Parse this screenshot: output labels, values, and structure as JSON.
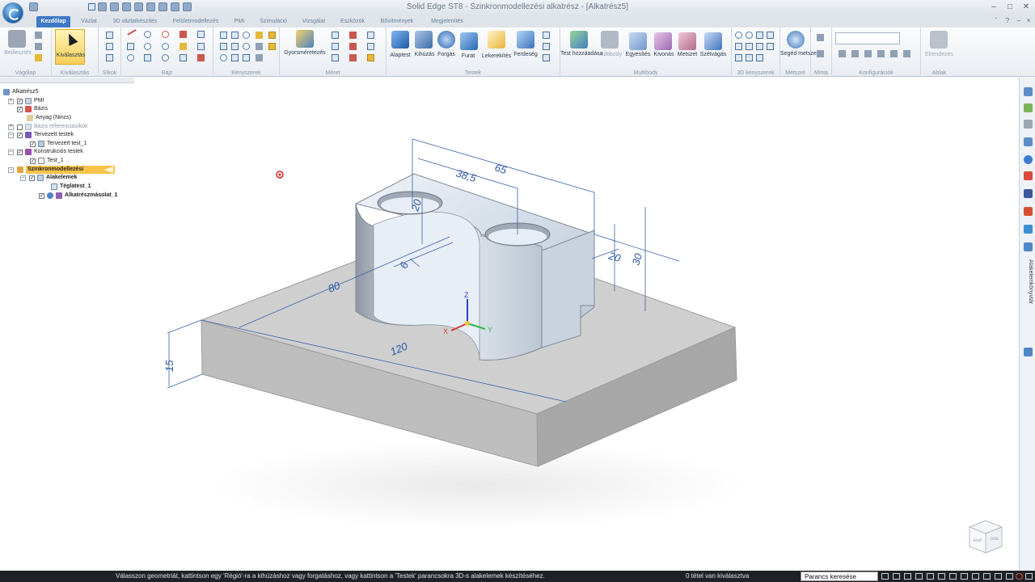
{
  "window": {
    "title": "Solid Edge ST8 - Szinkronmodellezési alkatrész - [Alkatrész5]"
  },
  "tabs": [
    {
      "label": "Kezdőlap",
      "active": true
    },
    {
      "label": "Vázlat"
    },
    {
      "label": "3D vázlatkészítés"
    },
    {
      "label": "Felületmodellezés"
    },
    {
      "label": "PMI"
    },
    {
      "label": "Szimuláció"
    },
    {
      "label": "Vizsgálat"
    },
    {
      "label": "Eszközök"
    },
    {
      "label": "Bővítmények"
    },
    {
      "label": "Megjelenítés"
    }
  ],
  "ribbon": {
    "groups": [
      {
        "label": "Vágólap"
      },
      {
        "label": "Kiválasztás"
      },
      {
        "label": "Síkok"
      },
      {
        "label": "Rajz"
      },
      {
        "label": "Kényszerek"
      },
      {
        "label": "Méret"
      },
      {
        "label": "Testek"
      },
      {
        "label": "Multibody"
      },
      {
        "label": "3D kényszerek"
      },
      {
        "label": "Metszet"
      },
      {
        "label": "Minta"
      },
      {
        "label": "Konfigurációk"
      },
      {
        "label": "Ablak"
      }
    ],
    "buttons": {
      "paste": "Beillesztés",
      "select": "Kiválasztás",
      "smart_dimension": "Gyorsméretezés",
      "extrude": "Alaptest",
      "pull": "Kihúzás",
      "revolve": "Forgás",
      "hole": "Furat",
      "round": "Lekerekítés",
      "chamfer": "Ferdeség",
      "add_body": "Test hozzáadása",
      "multibody": "Multibody",
      "union": "Egyesítés",
      "subtract": "Kivonás",
      "intersect": "Metszet",
      "split": "Szétvágás",
      "helper_section": "Segéd metszet",
      "arrange": "Elrendezés"
    }
  },
  "pathfinder": {
    "items": [
      {
        "label": "Alkatrész5",
        "level": 0
      },
      {
        "label": "PMI",
        "level": 1,
        "checked": true
      },
      {
        "label": "Bázis",
        "level": 1,
        "checked": true
      },
      {
        "label": "Anyag (Nincs)",
        "level": 2
      },
      {
        "label": "Bázis referenciasíkok",
        "level": 1,
        "checked": false,
        "dim": true
      },
      {
        "label": "Tervezett testek",
        "level": 1,
        "checked": true
      },
      {
        "label": "Tervezett test_1",
        "level": 2,
        "checked": true
      },
      {
        "label": "Konstrukciós testek",
        "level": 1,
        "checked": true
      },
      {
        "label": "Test_1",
        "level": 2,
        "checked": true
      },
      {
        "label": "Szinkronmodellezési",
        "level": 1,
        "highlighted": true
      },
      {
        "label": "Alakelemek",
        "level": 2,
        "checked": true
      },
      {
        "label": "Téglatest_1",
        "level": 3
      },
      {
        "label": "Alkatrészmásolat_1",
        "level": 3,
        "checked": true
      }
    ]
  },
  "dimensions": {
    "d65": "65",
    "d38_5": "38,5",
    "d20a": "20",
    "d20b": "20",
    "d30": "30",
    "d6": "6",
    "d80": "80",
    "d120": "120",
    "d15": "15"
  },
  "triad": {
    "x": "X",
    "y": "Y",
    "z": "Z"
  },
  "view_cube": {
    "front": "Első",
    "right": "Jobb"
  },
  "right_dock": {
    "title": "Alakelemkönyvtár"
  },
  "statusbar": {
    "message": "Válasszon geometriát, kattintson egy 'Régió'-ra a kihúzáshoz vagy forgatáshoz, vagy kattintson a 'Testek' parancsokra 3D-s alakelemek készítéséhez.",
    "selection_count": "0 tétel van kiválasztva",
    "command_finder": "Parancs keresése"
  },
  "colors": {
    "ribbon_tab_active": "#3f78c6",
    "highlight": "#f7c34a",
    "dimension_blue": "#2050a0",
    "status_bg": "#1e2126"
  }
}
